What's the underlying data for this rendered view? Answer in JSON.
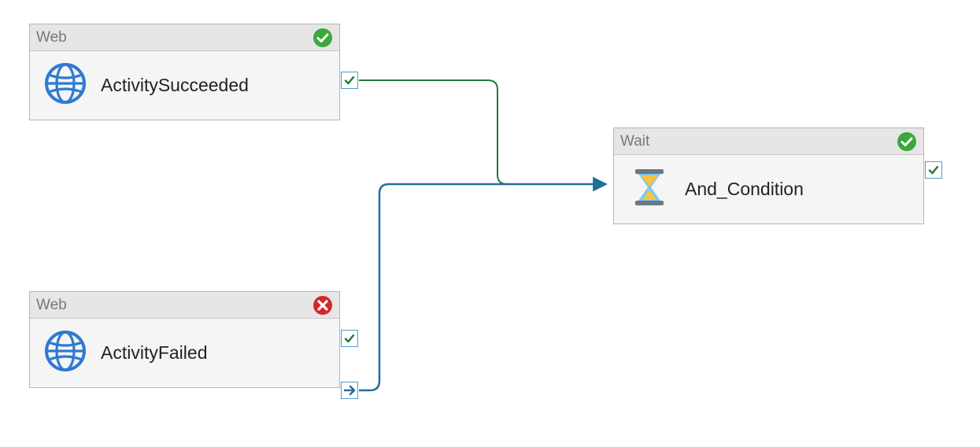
{
  "nodes": {
    "succeeded": {
      "type_label": "Web",
      "name": "ActivitySucceeded",
      "status": "success",
      "icon": "globe-icon",
      "ports": {
        "out_success": {
          "kind": "success"
        }
      }
    },
    "failed": {
      "type_label": "Web",
      "name": "ActivityFailed",
      "status": "error",
      "icon": "globe-icon",
      "ports": {
        "out_success": {
          "kind": "success"
        },
        "out_completion": {
          "kind": "completion"
        }
      }
    },
    "wait": {
      "type_label": "Wait",
      "name": "And_Condition",
      "status": "success",
      "icon": "hourglass-icon",
      "ports": {
        "out_success": {
          "kind": "success"
        }
      }
    }
  },
  "connectors": [
    {
      "from": "succeeded.out_success",
      "to": "wait",
      "color": "#1e7a3e"
    },
    {
      "from": "failed.out_completion",
      "to": "wait",
      "color": "#1f6f9a"
    }
  ],
  "colors": {
    "success_green": "#3aa83a",
    "error_red": "#d62626",
    "port_border": "#4f9dd0",
    "connector_green": "#1e7a3e",
    "connector_blue": "#1f6f9a",
    "globe_blue": "#2f7ad1",
    "hourglass_frame": "#6a7883",
    "hourglass_glass": "#7dc8f0",
    "hourglass_sand": "#f4c542"
  }
}
